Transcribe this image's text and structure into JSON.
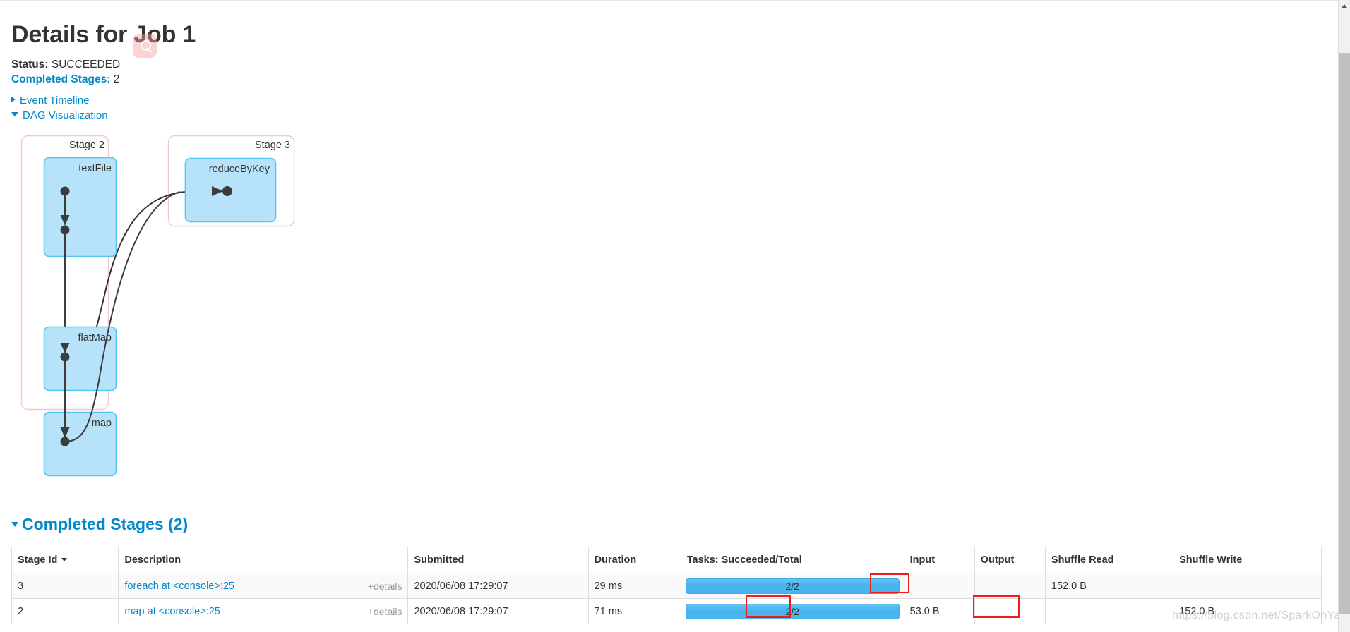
{
  "header": {
    "title": "Details for Job 1",
    "status_label": "Status:",
    "status_value": "SUCCEEDED",
    "completed_stages_label": "Completed Stages:",
    "completed_stages_value": "2"
  },
  "toggles": {
    "event_timeline": "Event Timeline",
    "dag_visualization": "DAG Visualization"
  },
  "dag": {
    "stages": [
      {
        "label": "Stage 2",
        "nodes": [
          {
            "label": "textFile"
          },
          {
            "label": "flatMap"
          },
          {
            "label": "map"
          }
        ]
      },
      {
        "label": "Stage 3",
        "nodes": [
          {
            "label": "reduceByKey"
          }
        ]
      }
    ]
  },
  "completed_section": {
    "heading": "Completed Stages (2)",
    "columns": [
      "Stage Id",
      "Description",
      "Submitted",
      "Duration",
      "Tasks: Succeeded/Total",
      "Input",
      "Output",
      "Shuffle Read",
      "Shuffle Write"
    ],
    "details_label": "+details",
    "rows": [
      {
        "stage_id": "3",
        "description": "foreach at <console>:25",
        "submitted": "2020/06/08 17:29:07",
        "duration": "29 ms",
        "tasks": "2/2",
        "tasks_percent": 100,
        "input": "",
        "output": "",
        "shuffle_read": "152.0 B",
        "shuffle_write": ""
      },
      {
        "stage_id": "2",
        "description": "map at <console>:25",
        "submitted": "2020/06/08 17:29:07",
        "duration": "71 ms",
        "tasks": "2/2",
        "tasks_percent": 100,
        "input": "53.0 B",
        "output": "",
        "shuffle_read": "",
        "shuffle_write": "152.0 B"
      }
    ]
  },
  "watermark": "https://blog.csdn.net/SparkOnYarn",
  "colors": {
    "link": "#0088cc",
    "node_fill": "#b7e3fa",
    "node_stroke": "#52c4f2",
    "stage_border": "#f7c5cf",
    "progress_fill": "#4ab4ef",
    "annotation": "#ef1c1c",
    "text": "#333333"
  }
}
